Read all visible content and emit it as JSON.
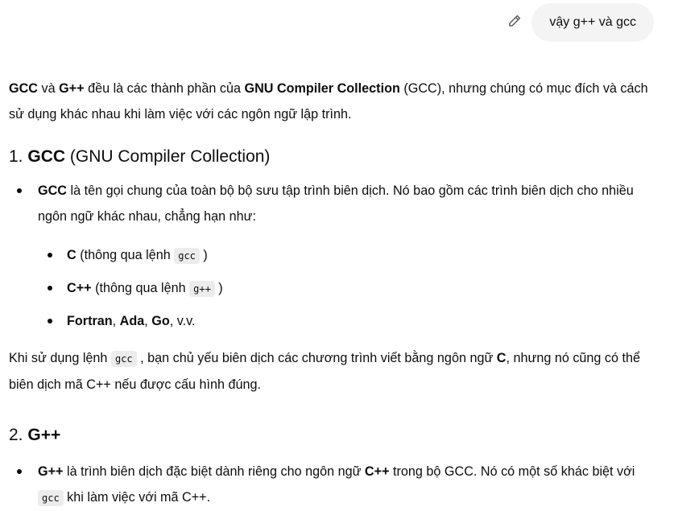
{
  "user_message": "vậy g++ và gcc",
  "answer": {
    "intro": {
      "t1": "GCC",
      "t2": " và ",
      "t3": "G++",
      "t4": " đều là các thành phần của ",
      "t5": "GNU Compiler Collection",
      "t6": " (GCC), nhưng chúng có mục đích và cách sử dụng khác nhau khi làm việc với các ngôn ngữ lập trình."
    },
    "section1": {
      "num": "1. ",
      "title_bold": "GCC",
      "title_rest": " (GNU Compiler Collection)",
      "bullet": {
        "b": "GCC",
        "rest": " là tên gọi chung của toàn bộ bộ sưu tập trình biên dịch. Nó bao gồm các trình biên dịch cho nhiều ngôn ngữ khác nhau, chẳng hạn như:"
      },
      "sub_items": [
        {
          "b": "C",
          "pre": " (thông qua lệnh ",
          "code": "gcc",
          "post": " )"
        },
        {
          "b": "C++",
          "pre": " (thông qua lệnh ",
          "code": "g++",
          "post": " )"
        }
      ],
      "sub_last": {
        "b1": "Fortran",
        "s1": ", ",
        "b2": "Ada",
        "s2": ", ",
        "b3": "Go",
        "s3": ", v.v."
      },
      "para": {
        "p1": "Khi sử dụng lệnh ",
        "code": "gcc",
        "p2": " , bạn chủ yếu biên dịch các chương trình viết bằng ngôn ngữ ",
        "b": "C",
        "p3": ", nhưng nó cũng có thể biên dịch mã C++ nếu được cấu hình đúng."
      }
    },
    "section2": {
      "num": "2. ",
      "title_bold": "G++",
      "bullet": {
        "b1": "G++",
        "p1": " là trình biên dịch đặc biệt dành riêng cho ngôn ngữ ",
        "b2": "C++",
        "p2": " trong bộ GCC. Nó có một số khác biệt với ",
        "code": "gcc",
        "p3": " khi làm việc với mã C++."
      }
    }
  }
}
